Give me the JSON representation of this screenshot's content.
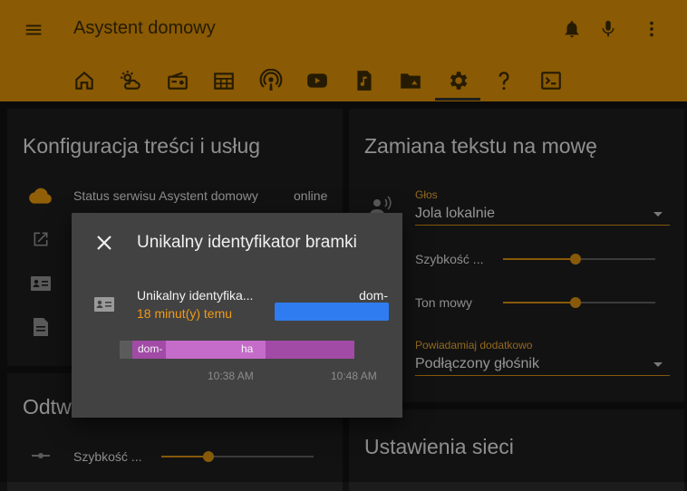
{
  "header": {
    "menu_icon": "menu-icon",
    "title": "Asystent domowy",
    "actions": [
      "bell-icon",
      "microphone-icon",
      "more-vertical-icon"
    ],
    "tabs": [
      "home-icon",
      "weather-icon",
      "radio-icon",
      "calendar-icon",
      "podcast-icon",
      "youtube-icon",
      "music-file-icon",
      "folder-icon",
      "settings-icon",
      "help-icon",
      "terminal-icon"
    ],
    "accent": "#d48b07"
  },
  "left_card": {
    "title": "Konfiguracja treści i usług",
    "status_label": "Status serwisu Asystent domowy",
    "status_value": "online"
  },
  "playback_card": {
    "title": "Odtw",
    "speed_label": "Szybkość ..."
  },
  "tts_card": {
    "title": "Zamiana tekstu na mowę",
    "voice_label": "Głos",
    "voice_value": "Jola lokalnie",
    "speed_label": "Szybkość ...",
    "speed_value": 0.48,
    "tone_label": "Ton mowy",
    "tone_value": 0.48,
    "notify_label": "Powiadamiaj dodatkowo",
    "notify_value": "Podłączony głośnik"
  },
  "network_card": {
    "title": "Ustawienia sieci"
  },
  "dialog": {
    "title": "Unikalny identyfikator bramki",
    "entity_name": "Unikalny identyfika...",
    "last_changed": "18 minut(y) temu",
    "state_prefix": "dom-",
    "timeline_label": "dom-",
    "timeline_suffix": "ha",
    "ticks": [
      "10:38 AM",
      "10:48 AM"
    ]
  }
}
